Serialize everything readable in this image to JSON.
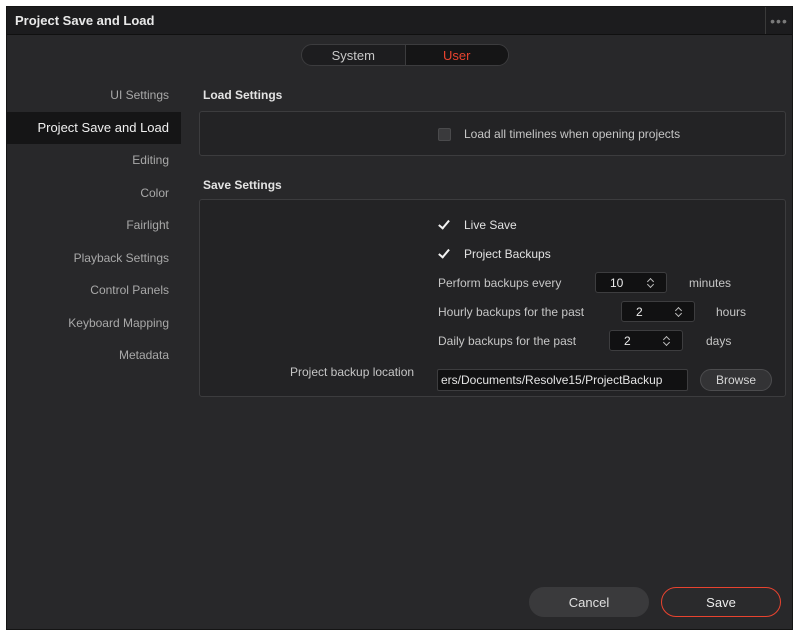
{
  "window": {
    "title": "Project Save and Load",
    "more_icon": "•••"
  },
  "scope_tabs": [
    {
      "label": "System",
      "active": false
    },
    {
      "label": "User",
      "active": true
    }
  ],
  "sidebar": {
    "items": [
      {
        "label": "UI Settings",
        "active": false
      },
      {
        "label": "Project Save and Load",
        "active": true
      },
      {
        "label": "Editing",
        "active": false
      },
      {
        "label": "Color",
        "active": false
      },
      {
        "label": "Fairlight",
        "active": false
      },
      {
        "label": "Playback Settings",
        "active": false
      },
      {
        "label": "Control Panels",
        "active": false
      },
      {
        "label": "Keyboard Mapping",
        "active": false
      },
      {
        "label": "Metadata",
        "active": false
      }
    ]
  },
  "load_settings": {
    "title": "Load Settings",
    "load_all_timelines": {
      "label": "Load all timelines when opening projects",
      "checked": false
    }
  },
  "save_settings": {
    "title": "Save Settings",
    "live_save": {
      "label": "Live Save",
      "checked": true
    },
    "project_backups": {
      "label": "Project Backups",
      "checked": true
    },
    "perform_every": {
      "label": "Perform backups every",
      "value": "10",
      "unit": "minutes"
    },
    "hourly": {
      "label": "Hourly backups for the past",
      "value": "2",
      "unit": "hours"
    },
    "daily": {
      "label": "Daily backups for the past",
      "value": "2",
      "unit": "days"
    },
    "backup_location": {
      "label": "Project backup location",
      "value": "ers/Documents/Resolve15/ProjectBackup",
      "browse_label": "Browse"
    }
  },
  "footer": {
    "cancel_label": "Cancel",
    "save_label": "Save"
  },
  "colors": {
    "accent": "#e8432f",
    "background": "#28282a",
    "panel": "#232325"
  }
}
